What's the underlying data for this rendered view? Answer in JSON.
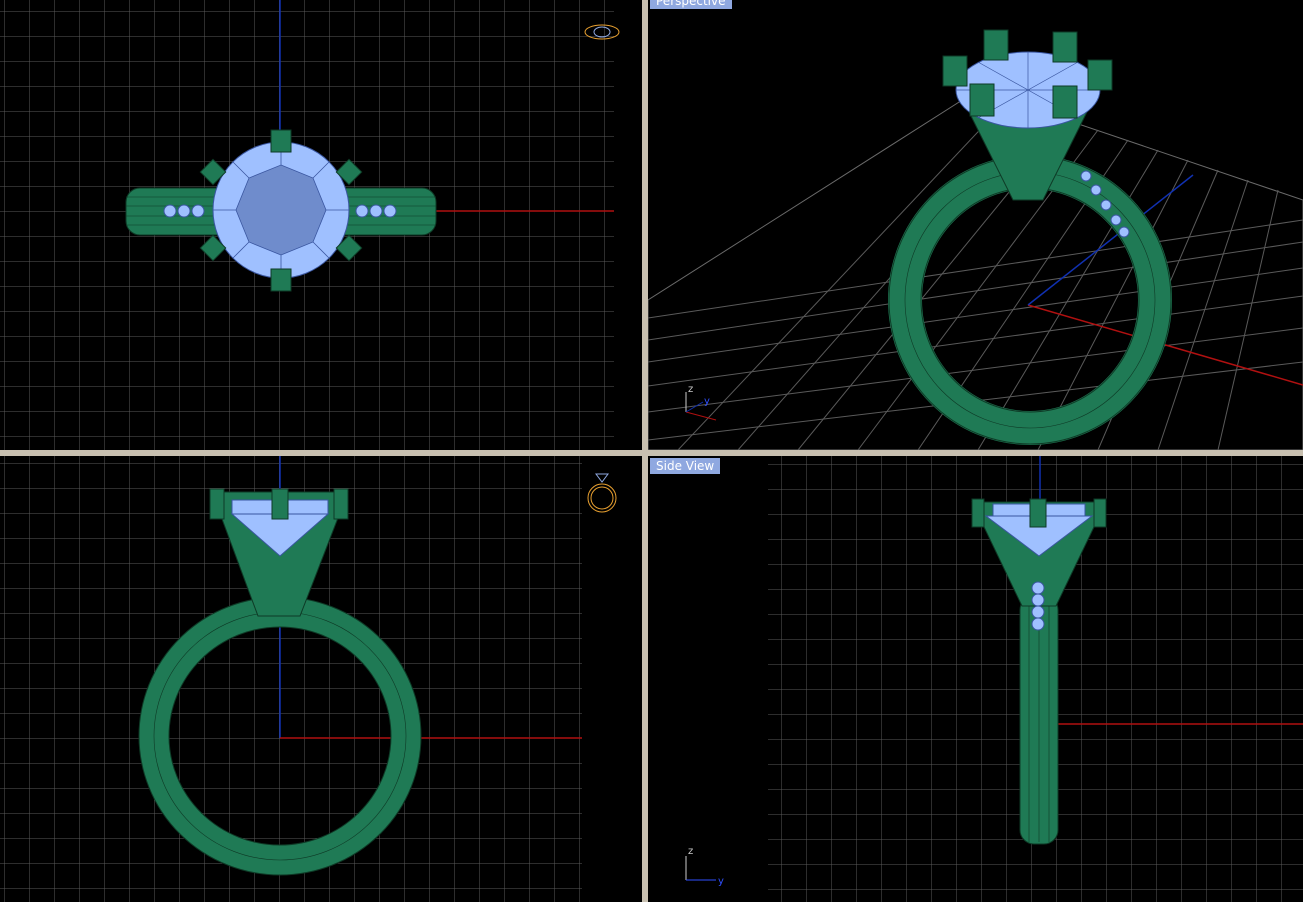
{
  "viewports": {
    "top": {
      "label": ""
    },
    "perspective": {
      "label": "Perspective"
    },
    "front": {
      "label": ""
    },
    "side": {
      "label": "Side View"
    }
  },
  "axis_icon": {
    "z": "z",
    "y": "y"
  },
  "colors": {
    "grid": "#5a5a5a",
    "metal": "#1f7a55",
    "metal_line": "#0e3a26",
    "gem": "#9fc0ff",
    "gem_line": "#3a56a0",
    "x_axis": "#b01010",
    "y_axis": "#1030b0",
    "label_bg": "#8fa8e0",
    "nav_icon": "#e8a030"
  },
  "icons": [
    "ring-top-nav-icon",
    "ring-front-nav-icon",
    "axis-triad-icon"
  ]
}
